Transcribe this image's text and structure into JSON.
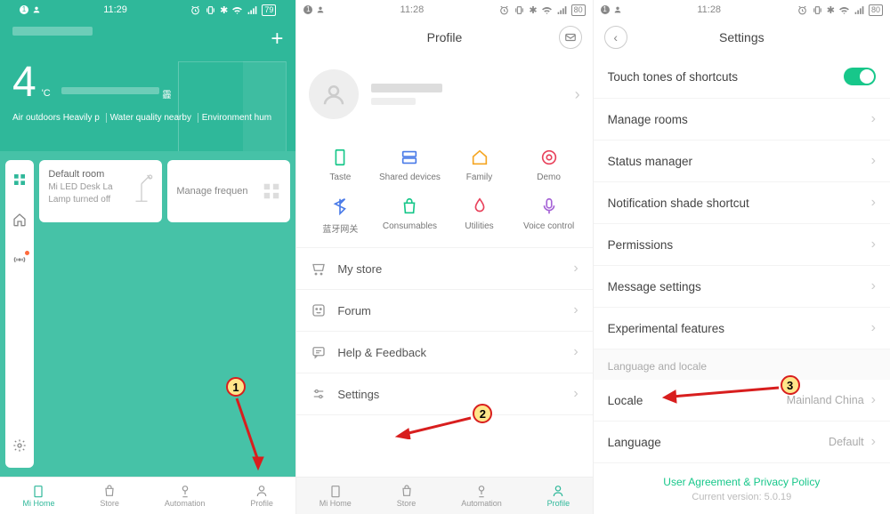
{
  "status": {
    "time_s1": "11:29",
    "time_s2": "11:28",
    "time_s3": "11:28",
    "battery_s1": "79",
    "battery_s2": "80",
    "battery_s3": "80"
  },
  "screen1": {
    "temperature": "4",
    "unit": "'C",
    "weather_icon_label": "霾",
    "weather": [
      "Air outdoors Heavily p",
      "Water quality nearby",
      "Environment hum"
    ],
    "card1": {
      "title": "Default room",
      "sub1": "Mi LED Desk La",
      "sub2": "Lamp turned off"
    },
    "card2": {
      "title": "Manage frequen"
    },
    "nav": [
      "Mi Home",
      "Store",
      "Automation",
      "Profile"
    ]
  },
  "screen2": {
    "title": "Profile",
    "grid": [
      "Taste",
      "Shared devices",
      "Family",
      "Demo",
      "蓝牙网关",
      "Consumables",
      "Utilities",
      "Voice control"
    ],
    "menu": [
      "My store",
      "Forum",
      "Help & Feedback",
      "Settings"
    ],
    "nav": [
      "Mi Home",
      "Store",
      "Automation",
      "Profile"
    ]
  },
  "screen3": {
    "title": "Settings",
    "rows": [
      "Touch tones of shortcuts",
      "Manage rooms",
      "Status manager",
      "Notification shade shortcut",
      "Permissions",
      "Message settings",
      "Experimental features"
    ],
    "section": "Language and locale",
    "locale_label": "Locale",
    "locale_value": "Mainland China",
    "language_label": "Language",
    "language_value": "Default",
    "footer_link": "User Agreement & Privacy Policy",
    "footer_version": "Current version: 5.0.19"
  },
  "annotations": {
    "n1": "1",
    "n2": "2",
    "n3": "3"
  }
}
